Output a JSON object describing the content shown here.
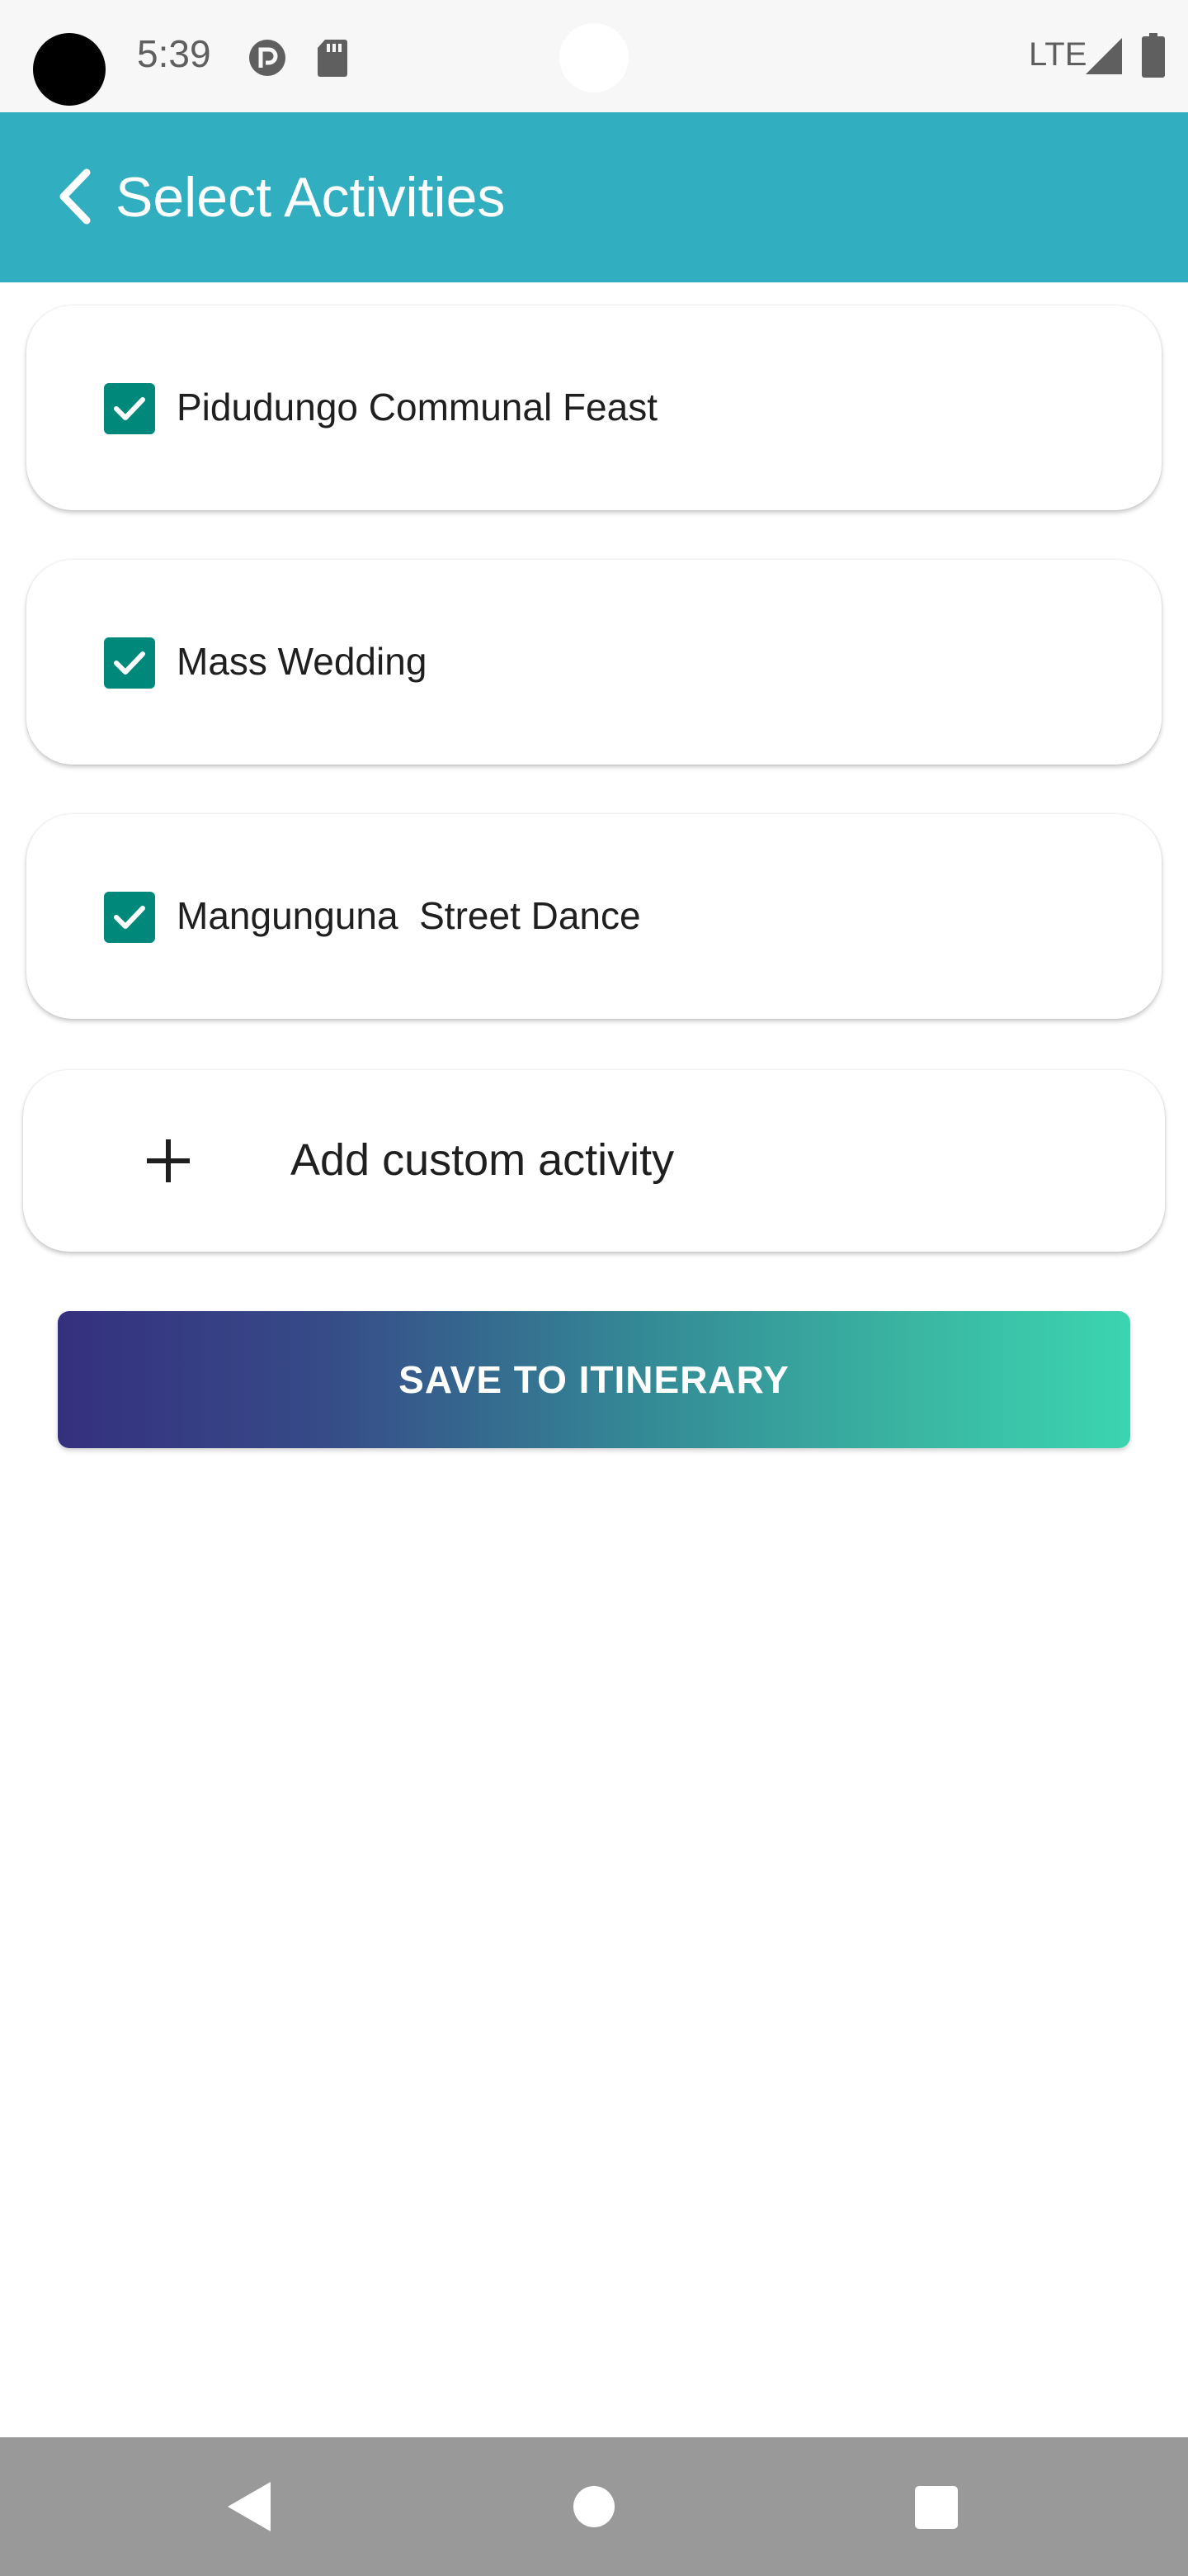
{
  "status_bar": {
    "time": "5:39",
    "network": "LTE",
    "icons": [
      "pocket-casts-icon",
      "sd-card-icon",
      "signal-icon",
      "battery-icon"
    ]
  },
  "app_bar": {
    "title": "Select Activities",
    "back_icon": "chevron-left-icon",
    "background": "#31aebf"
  },
  "activities": [
    {
      "label": "Pidudungo Communal Feast",
      "checked": true
    },
    {
      "label": "Mass Wedding",
      "checked": true
    },
    {
      "label": "Mangunguna  Street Dance",
      "checked": true
    }
  ],
  "add_custom": {
    "label": "Add custom activity",
    "icon": "plus-icon"
  },
  "save_button": {
    "label": "SAVE TO ITINERARY",
    "gradient": [
      "#35307e",
      "#3bd5b0"
    ]
  },
  "nav_bar": {
    "icons": [
      "nav-back-icon",
      "nav-home-icon",
      "nav-recents-icon"
    ]
  },
  "colors": {
    "checkbox": "#00897b",
    "nav_bar": "#999999"
  }
}
